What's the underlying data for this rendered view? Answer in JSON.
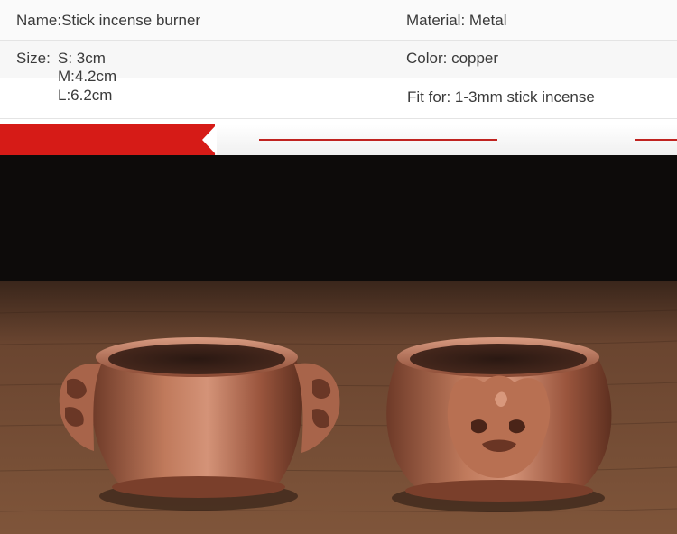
{
  "specs": {
    "name": "Name:Stick incense burner",
    "material": "Material: Metal",
    "size_label": "Size:",
    "size_s": "S: 3cm",
    "size_m": "M:4.2cm",
    "size_l": "L:6.2cm",
    "color": "Color: copper",
    "fit": "Fit for: 1-3mm stick incense"
  },
  "colors": {
    "accent_red": "#d61b17",
    "copper": "#b46a4c"
  },
  "photo": {
    "subject": "two copper incense burners with lion-head handles"
  }
}
